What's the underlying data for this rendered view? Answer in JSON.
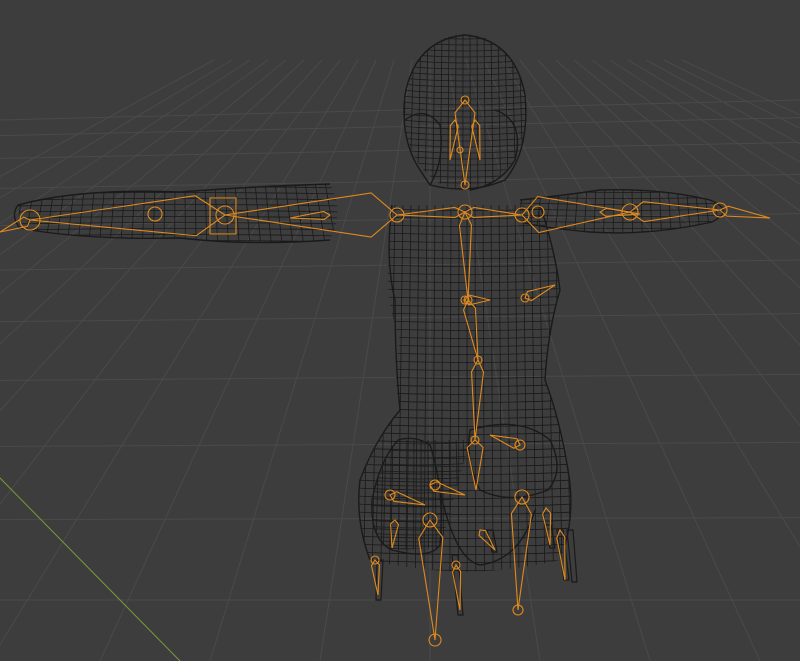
{
  "viewport": {
    "kind": "3d-viewport",
    "shading": "wireframe",
    "background_color": "#3d3d3d",
    "grid_color": "#4a4a4a",
    "axis_color_y": "#7a9a3a",
    "mesh_color": "#1a1a1a",
    "armature_color": "#e08a1e"
  },
  "scene": {
    "mesh_object": "humanoid-figure-mesh",
    "armature_object": "humanoid-armature",
    "pose": "t-pose"
  }
}
